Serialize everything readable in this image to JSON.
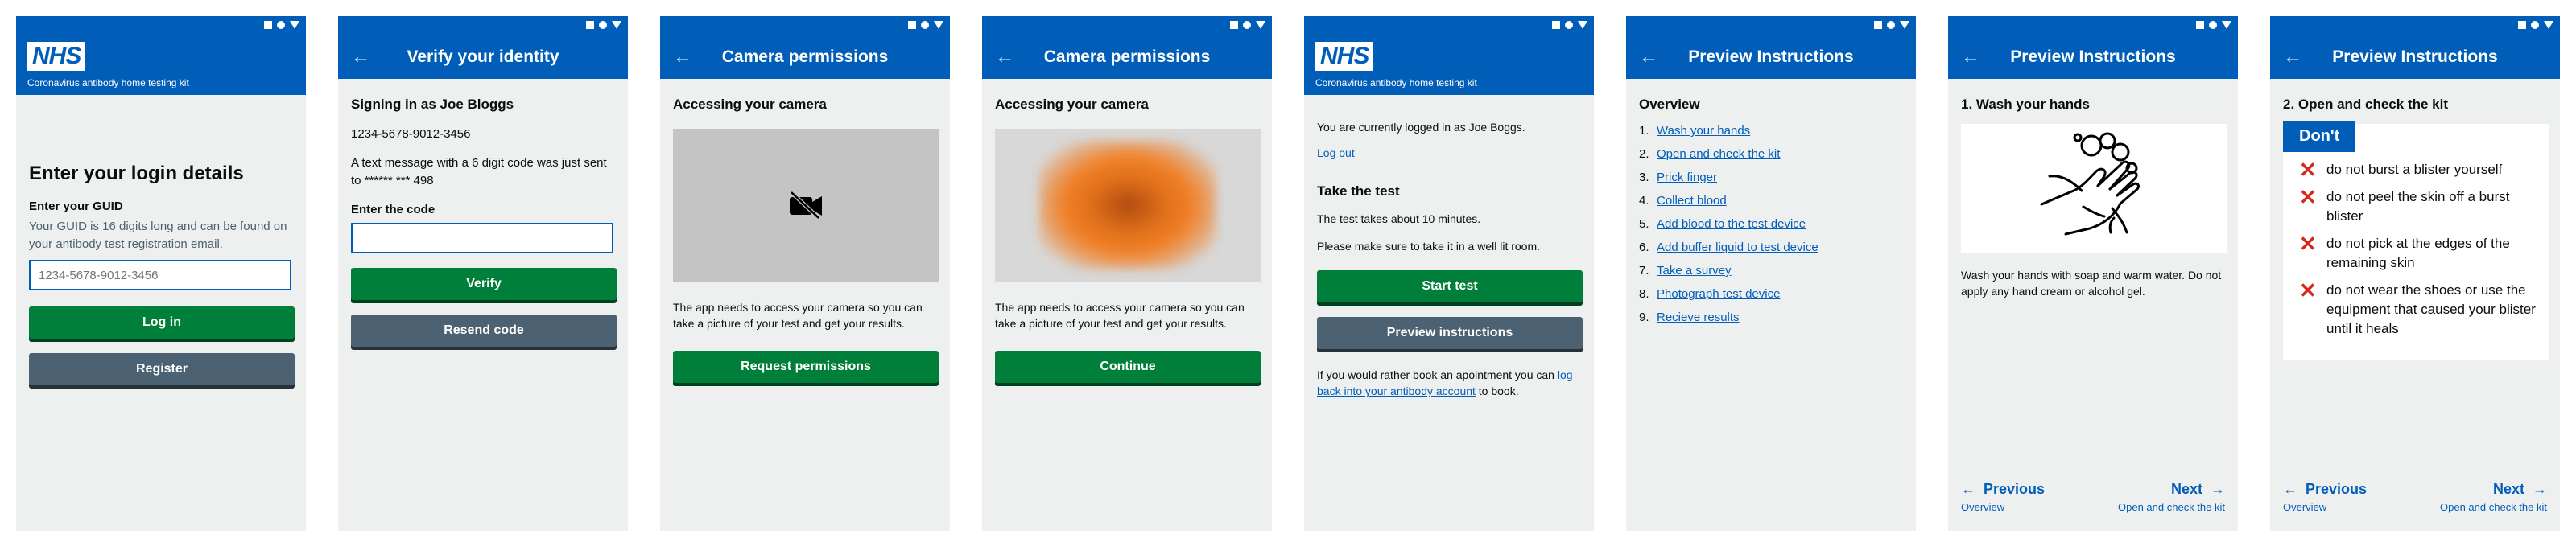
{
  "colors": {
    "nhs_blue": "#005eb8",
    "green": "#007f3b",
    "grey": "#4c6272",
    "red": "#d5281b",
    "background": "#eef0f0"
  },
  "brand": {
    "logo": "NHS",
    "subtitle": "Coronavirus antibody home testing kit"
  },
  "screen1": {
    "heading": "Enter your login details",
    "guid_label": "Enter your GUID",
    "guid_hint": "Your GUID is 16 digits long and can be found on your antibody test registration email.",
    "guid_placeholder": "1234-5678-9012-3456",
    "login_button": "Log in",
    "register_button": "Register"
  },
  "screen2": {
    "title": "Verify your identity",
    "signing_in": "Signing in as Joe Bloggs",
    "guid": "1234-5678-9012-3456",
    "message": "A text message with a 6 digit code was just sent to ****** *** 498",
    "code_label": "Enter the code",
    "code_value": "",
    "verify_button": "Verify",
    "resend_button": "Resend code"
  },
  "screen3": {
    "title": "Camera permissions",
    "heading": "Accessing your camera",
    "camera_icon": "camera-off-icon",
    "body": "The app needs to access your camera so you can take a picture of your test and get your results.",
    "button": "Request permissions"
  },
  "screen4": {
    "title": "Camera permissions",
    "heading": "Accessing your camera",
    "body": "The app needs to access your camera so you can take a picture of your test and get your results.",
    "button": "Continue"
  },
  "screen5": {
    "logged_in": "You are currently logged in as Joe Boggs.",
    "logout": "Log out",
    "heading": "Take the test",
    "duration": "The test takes about 10 minutes.",
    "lighting": "Please make sure to take it in a well lit room.",
    "start_button": "Start test",
    "preview_button": "Preview instructions",
    "book_prefix": "If you would rather book an apointment you can ",
    "book_link": "log back into your antibody account",
    "book_suffix": " to book."
  },
  "screen6": {
    "title": "Preview Instructions",
    "heading": "Overview",
    "items": [
      {
        "num": "1.",
        "label": "Wash your hands"
      },
      {
        "num": "2.",
        "label": "Open and check the kit"
      },
      {
        "num": "3.",
        "label": "Prick finger"
      },
      {
        "num": "4.",
        "label": "Collect blood"
      },
      {
        "num": "5.",
        "label": "Add blood to the test device"
      },
      {
        "num": "6.",
        "label": "Add buffer liquid to test device"
      },
      {
        "num": "7.",
        "label": "Take a survey"
      },
      {
        "num": "8.",
        "label": "Photograph test device"
      },
      {
        "num": "9.",
        "label": "Recieve results"
      }
    ]
  },
  "screen7": {
    "title": "Preview Instructions",
    "heading": "1. Wash your hands",
    "illustration_icon": "hand-washing-icon",
    "body": "Wash your hands with soap and warm water. Do not apply any hand cream or alcohol gel.",
    "prev_label": "Previous",
    "prev_sub": "Overview",
    "next_label": "Next",
    "next_sub": "Open and check the kit"
  },
  "screen8": {
    "title": "Preview Instructions",
    "heading": "2. Open and check the kit",
    "dont_heading": "Don't",
    "donts": [
      "do not burst a blister yourself",
      "do not peel the skin off a burst blister",
      "do not pick at the edges of the remaining skin",
      "do not wear the shoes or use the equipment that caused your blister until it heals"
    ],
    "prev_label": "Previous",
    "prev_sub": "Overview",
    "next_label": "Next",
    "next_sub": "Open and check the kit"
  }
}
